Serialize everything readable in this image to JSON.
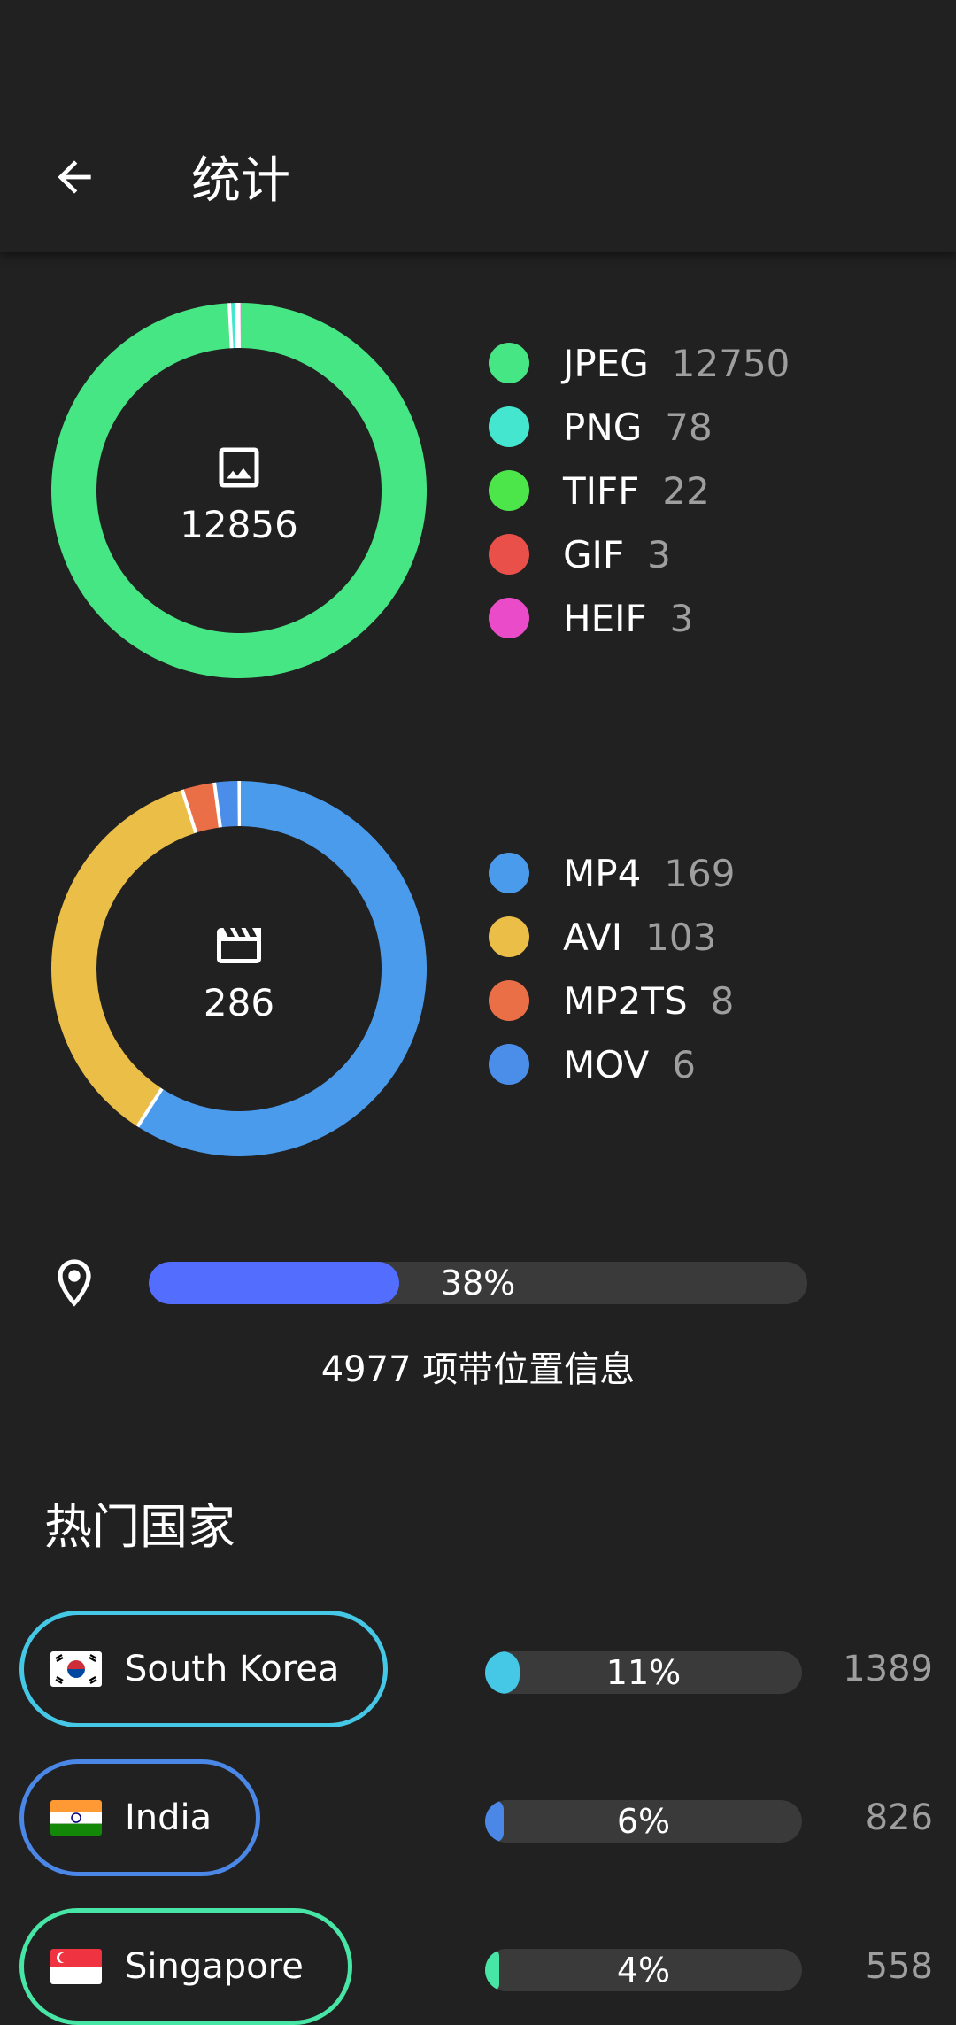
{
  "appbar": {
    "title": "统计"
  },
  "images": {
    "total": "12856",
    "icon": "image-icon",
    "formats": [
      {
        "name": "JPEG",
        "count": "12750",
        "color": "#47E684"
      },
      {
        "name": "PNG",
        "count": "78",
        "color": "#45E6CF"
      },
      {
        "name": "TIFF",
        "count": "22",
        "color": "#4CE64B"
      },
      {
        "name": "GIF",
        "count": "3",
        "color": "#EA504A"
      },
      {
        "name": "HEIF",
        "count": "3",
        "color": "#EA4BC9"
      }
    ]
  },
  "videos": {
    "total": "286",
    "icon": "video-icon",
    "formats": [
      {
        "name": "MP4",
        "count": "169",
        "color": "#4A9BEC"
      },
      {
        "name": "AVI",
        "count": "103",
        "color": "#EBBE47"
      },
      {
        "name": "MP2TS",
        "count": "8",
        "color": "#EA6E46"
      },
      {
        "name": "MOV",
        "count": "6",
        "color": "#4A8EEA"
      }
    ]
  },
  "location": {
    "icon": "location-pin-icon",
    "percent_label": "38%",
    "fraction": 0.38,
    "bar_color": "#536DFE",
    "caption": "4977 项带位置信息"
  },
  "top_countries": {
    "title": "热门国家",
    "items": [
      {
        "name": "South Korea",
        "percent_label": "11%",
        "fraction": 0.11,
        "count": "1389",
        "color": "#45C7E6",
        "flag": "south-korea-flag-icon"
      },
      {
        "name": "India",
        "percent_label": "6%",
        "fraction": 0.06,
        "count": "826",
        "color": "#4A87E6",
        "flag": "india-flag-icon"
      },
      {
        "name": "Singapore",
        "percent_label": "4%",
        "fraction": 0.04,
        "count": "558",
        "color": "#47E6A6",
        "flag": "singapore-flag-icon"
      }
    ]
  }
}
